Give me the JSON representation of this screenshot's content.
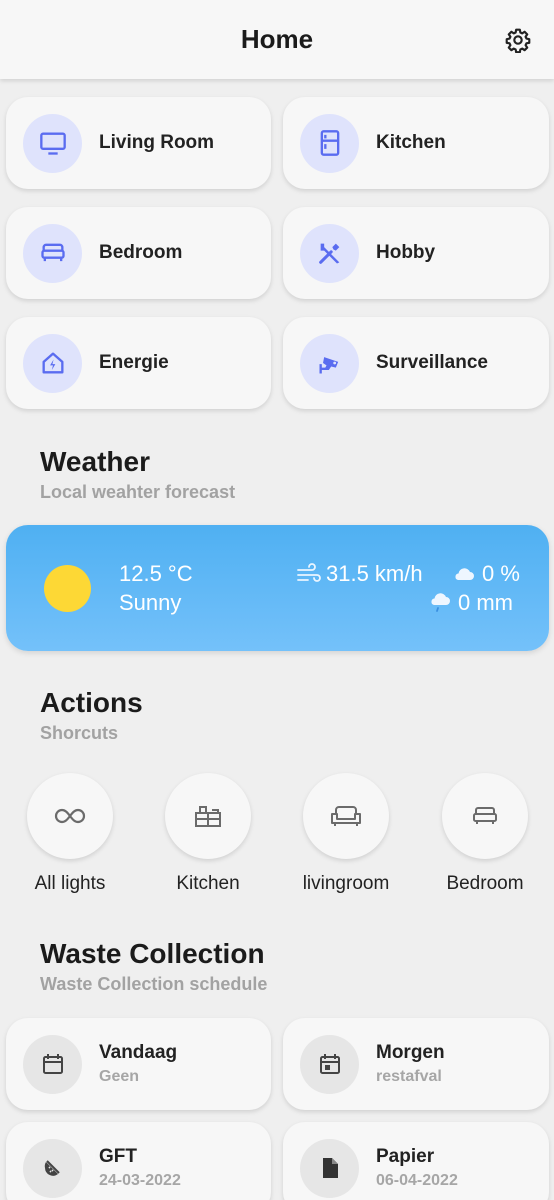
{
  "header": {
    "title": "Home",
    "settings_icon": "gear-icon"
  },
  "rooms": [
    {
      "label": "Living Room",
      "icon": "tv-icon"
    },
    {
      "label": "Kitchen",
      "icon": "fridge-icon"
    },
    {
      "label": "Bedroom",
      "icon": "bed-icon"
    },
    {
      "label": "Hobby",
      "icon": "tools-icon"
    },
    {
      "label": "Energie",
      "icon": "home-lightning-icon"
    },
    {
      "label": "Surveillance",
      "icon": "cctv-icon"
    }
  ],
  "weather": {
    "title": "Weather",
    "subtitle": "Local weahter forecast",
    "temperature": "12.5 °C",
    "condition": "Sunny",
    "wind": "31.5 km/h",
    "cloud": "0 %",
    "rain": "0 mm",
    "icon": "sun-icon"
  },
  "actions": {
    "title": "Actions",
    "subtitle": "Shorcuts",
    "items": [
      {
        "label": "All lights",
        "icon": "infinity-icon"
      },
      {
        "label": "Kitchen",
        "icon": "kitchen-counter-icon"
      },
      {
        "label": "livingroom",
        "icon": "sofa-icon"
      },
      {
        "label": "Bedroom",
        "icon": "bed-icon"
      }
    ]
  },
  "waste": {
    "title": "Waste Collection",
    "subtitle": "Waste Collection schedule",
    "items": [
      {
        "title": "Vandaag",
        "value": "Geen",
        "icon": "calendar-icon"
      },
      {
        "title": "Morgen",
        "value": "restafval",
        "icon": "calendar-today-icon"
      },
      {
        "title": "GFT",
        "value": "24-03-2022",
        "icon": "fruit-slice-icon"
      },
      {
        "title": "Papier",
        "value": "06-04-2022",
        "icon": "file-icon"
      }
    ]
  },
  "colors": {
    "accent_icon": "#5a6cf0",
    "icon_bg": "#dfe3fc",
    "weather_top": "#4fb0f2",
    "weather_bottom": "#74c1fa",
    "sun": "#fdd835"
  }
}
